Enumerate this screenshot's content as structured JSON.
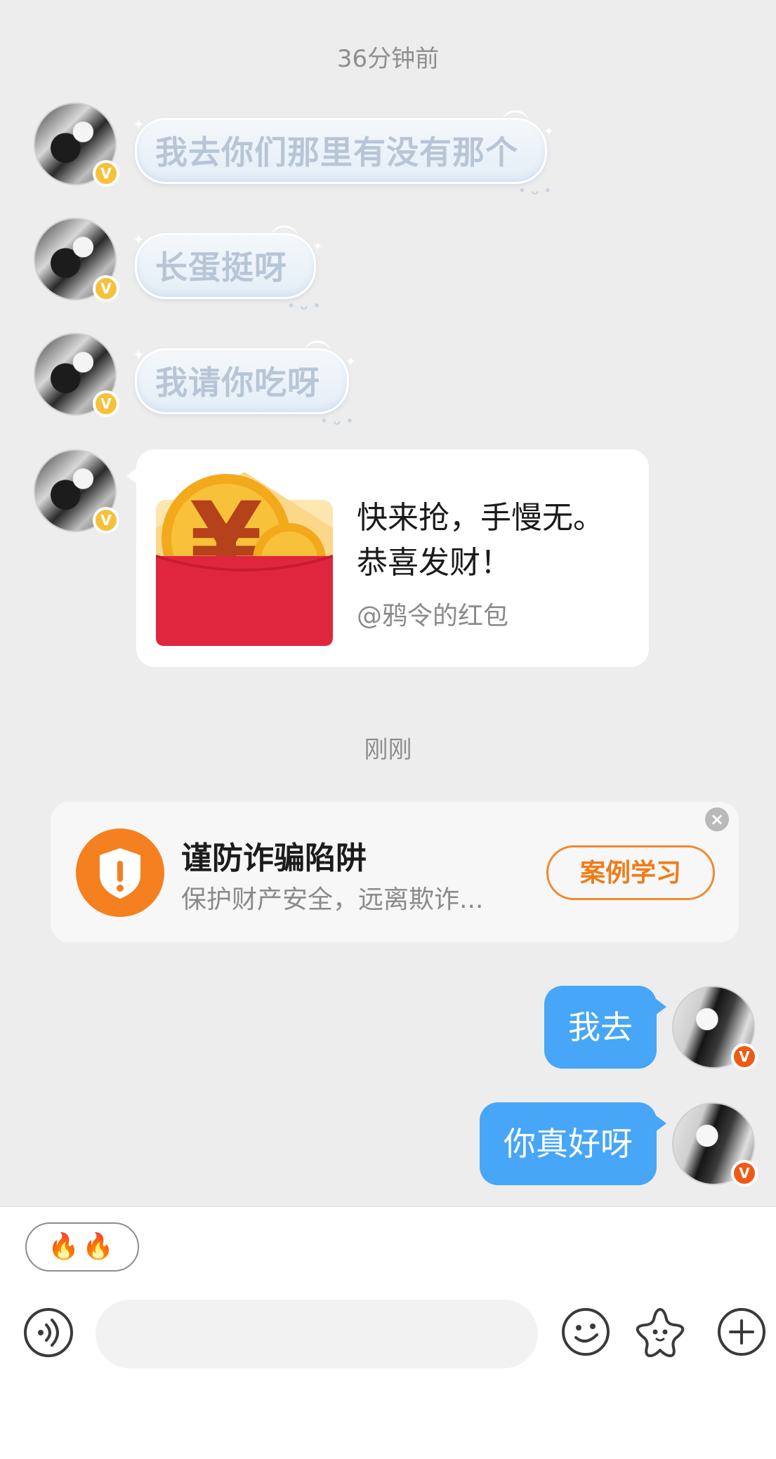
{
  "timestamps": {
    "first": "36分钟前",
    "second": "刚刚"
  },
  "incoming": [
    {
      "text": "我去你们那里有没有那个"
    },
    {
      "text": "长蛋挺呀"
    },
    {
      "text": "我请你吃呀"
    }
  ],
  "red_packet": {
    "title_line1": "快来抢，手慢无。",
    "title_line2": "恭喜发财！",
    "sender": "@鸦令的红包"
  },
  "fraud_warning": {
    "title": "谨防诈骗陷阱",
    "subtitle": "保护财产安全，远离欺诈...",
    "button": "案例学习",
    "close_symbol": "×"
  },
  "outgoing": [
    {
      "text": "我去"
    },
    {
      "text": "你真好呀"
    }
  ],
  "avatar_badge": "V",
  "input_bar": {
    "quick_reply": "🔥🔥",
    "placeholder": ""
  },
  "colors": {
    "background": "#ededed",
    "outgoing_bubble": "#47a6f7",
    "warning_orange": "#f5801f",
    "badge_gold": "#f6c13a",
    "badge_orange": "#ee5a16",
    "packet_red": "#e0263f"
  },
  "icons": [
    "voice-icon",
    "emoji-smile-icon",
    "sticker-star-icon",
    "plus-icon",
    "shield-alert-icon",
    "close-icon",
    "verified-badge-icon"
  ]
}
